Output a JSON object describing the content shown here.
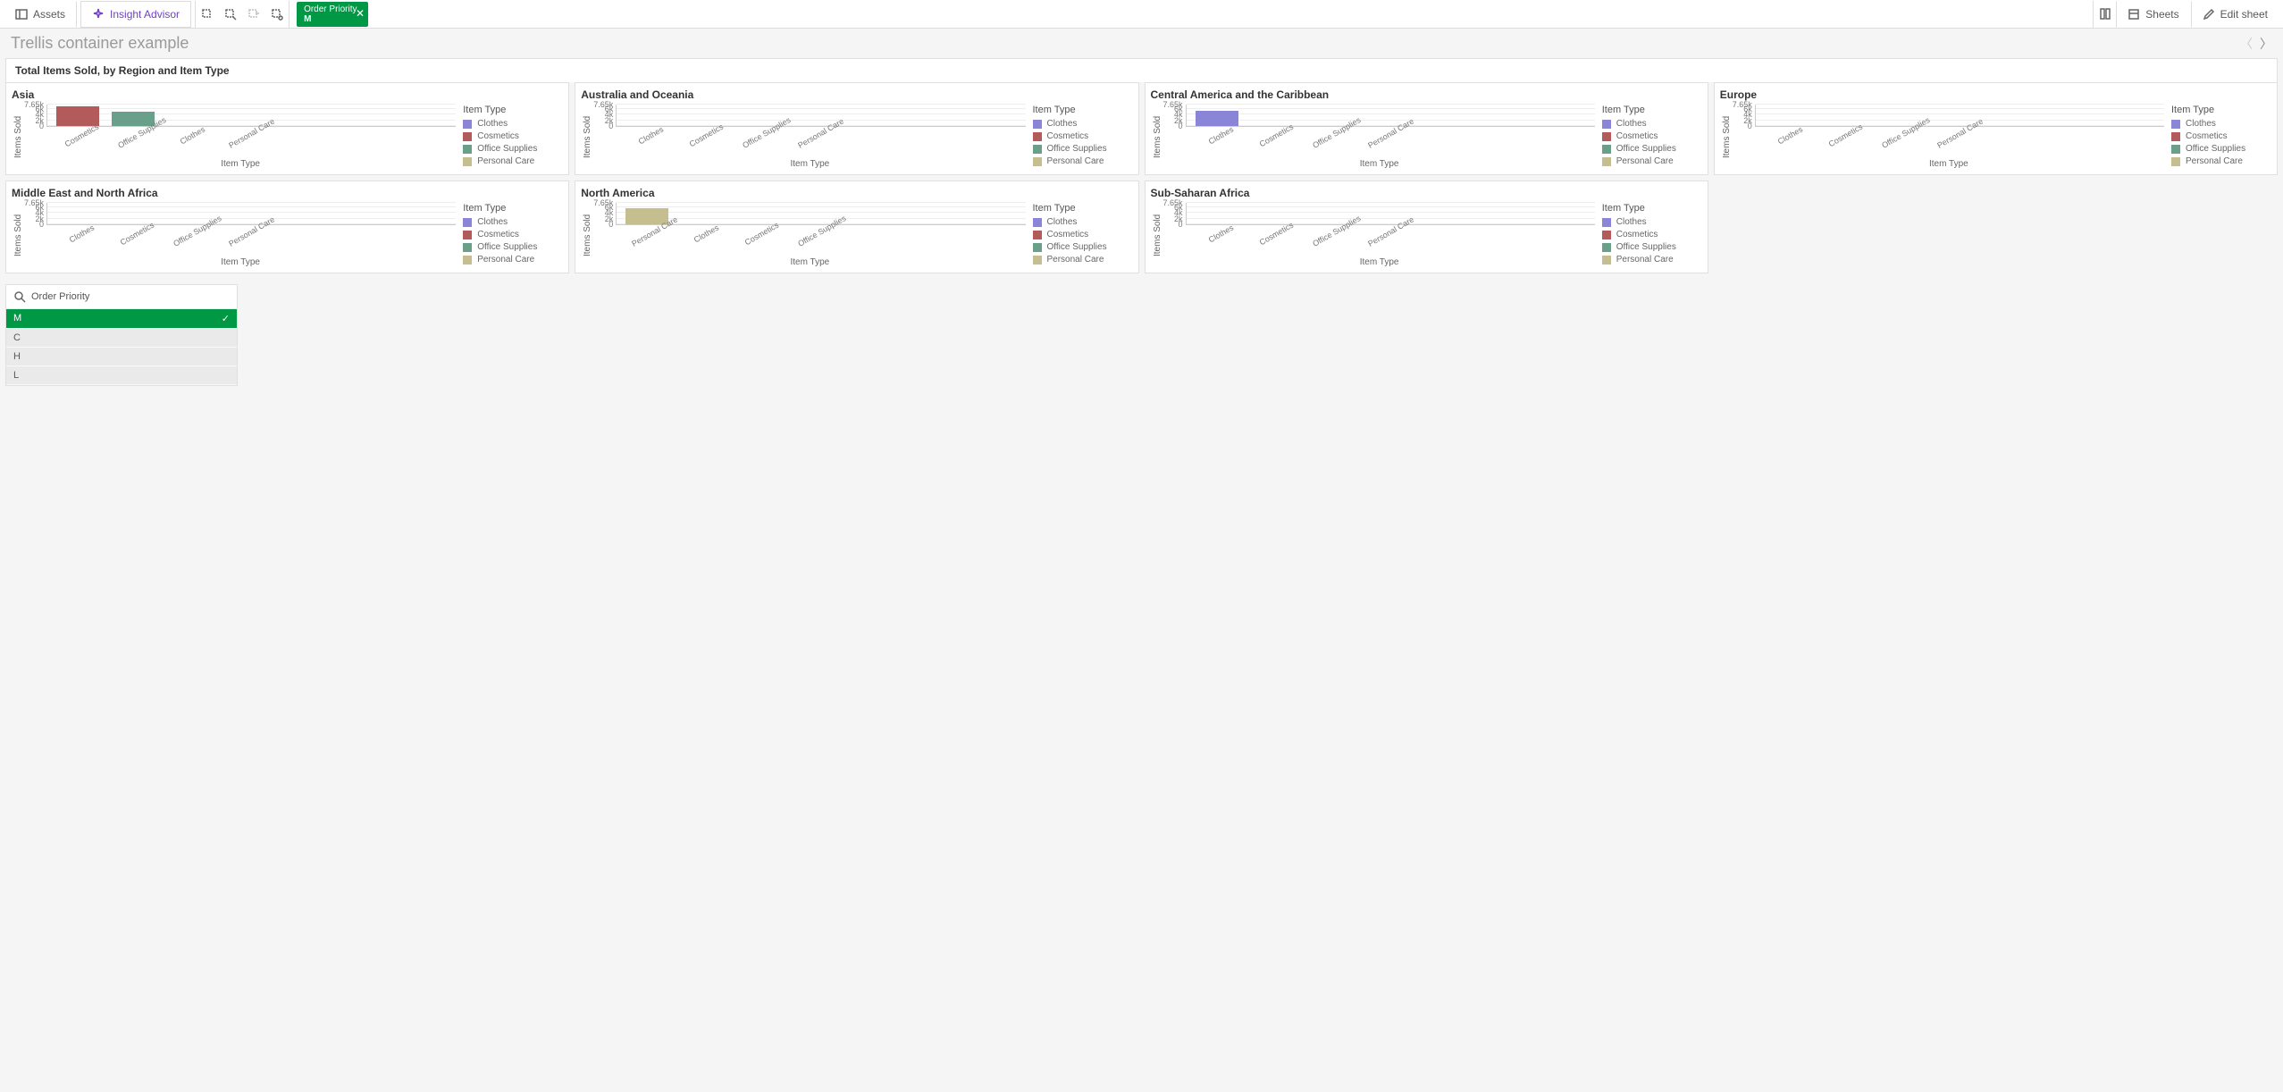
{
  "toolbar": {
    "assets": "Assets",
    "insight": "Insight Advisor",
    "sheets": "Sheets",
    "edit": "Edit sheet",
    "selection": {
      "field": "Order Priority",
      "value": "M"
    }
  },
  "sheet_title": "Trellis container example",
  "container_title": "Total Items Sold, by Region and Item Type",
  "legend_title": "Item Type",
  "yaxis": "Items Sold",
  "xaxis": "Item Type",
  "yticks": [
    "0",
    "2k",
    "4k",
    "6k",
    "7.65k"
  ],
  "ytick_pos": [
    0,
    26.1,
    52.3,
    78.4,
    100
  ],
  "colors": {
    "Clothes": "#8a85d6",
    "Cosmetics": "#b35a5a",
    "Office Supplies": "#6aa08a",
    "Personal Care": "#c5bf8f"
  },
  "legend_items": [
    "Clothes",
    "Cosmetics",
    "Office Supplies",
    "Personal Care"
  ],
  "chart_data": [
    {
      "region": "Asia",
      "type": "bar",
      "ylim": [
        0,
        7650
      ],
      "categories": [
        "Cosmetics",
        "Office Supplies",
        "Clothes",
        "Personal Care"
      ],
      "values": [
        7100,
        5000,
        0,
        0
      ]
    },
    {
      "region": "Australia and Oceania",
      "type": "bar",
      "ylim": [
        0,
        7650
      ],
      "categories": [
        "Clothes",
        "Cosmetics",
        "Office Supplies",
        "Personal Care"
      ],
      "values": [
        0,
        0,
        0,
        0
      ]
    },
    {
      "region": "Central America and the Caribbean",
      "type": "bar",
      "ylim": [
        0,
        7650
      ],
      "categories": [
        "Clothes",
        "Cosmetics",
        "Office Supplies",
        "Personal Care"
      ],
      "values": [
        5500,
        0,
        0,
        0
      ]
    },
    {
      "region": "Europe",
      "type": "bar",
      "ylim": [
        0,
        7650
      ],
      "categories": [
        "Clothes",
        "Cosmetics",
        "Office Supplies",
        "Personal Care"
      ],
      "values": [
        0,
        0,
        0,
        0
      ]
    },
    {
      "region": "Middle East and North Africa",
      "type": "bar",
      "ylim": [
        0,
        7650
      ],
      "categories": [
        "Clothes",
        "Cosmetics",
        "Office Supplies",
        "Personal Care"
      ],
      "values": [
        0,
        0,
        0,
        0
      ]
    },
    {
      "region": "North America",
      "type": "bar",
      "ylim": [
        0,
        7650
      ],
      "categories": [
        "Personal Care",
        "Clothes",
        "Cosmetics",
        "Office Supplies"
      ],
      "values": [
        5800,
        0,
        0,
        0
      ]
    },
    {
      "region": "Sub-Saharan Africa",
      "type": "bar",
      "ylim": [
        0,
        7650
      ],
      "categories": [
        "Clothes",
        "Cosmetics",
        "Office Supplies",
        "Personal Care"
      ],
      "values": [
        0,
        0,
        0,
        0
      ]
    }
  ],
  "filter": {
    "title": "Order Priority",
    "options": [
      "M",
      "C",
      "H",
      "L"
    ],
    "selected": "M"
  }
}
